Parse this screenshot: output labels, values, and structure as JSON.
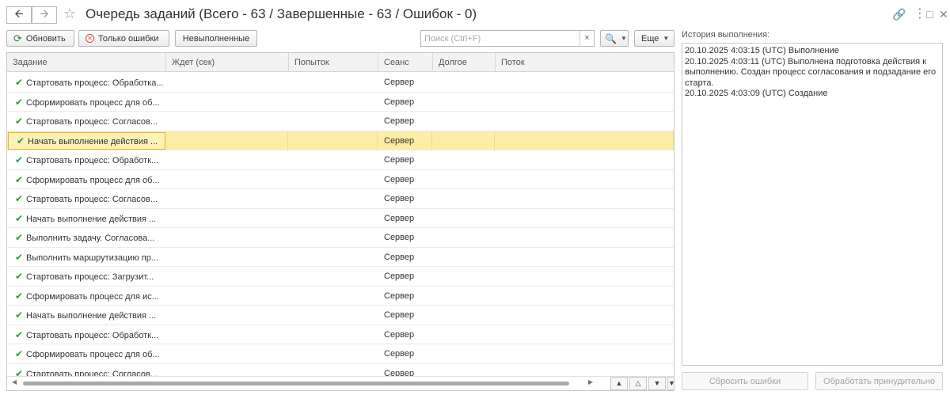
{
  "window": {
    "title": "Очередь заданий (Всего - 63 / Завершенные - 63 / Ошибок - 0)",
    "back_icon": "arrow-left-icon",
    "forward_icon": "arrow-right-icon",
    "favorite_icon": "star-icon",
    "link_icon": "link-icon",
    "menu_icon": "kebab-menu-icon",
    "maximize_icon": "maximize-icon",
    "close_icon": "close-icon"
  },
  "toolbar": {
    "refresh_label": "Обновить",
    "only_errors_label": "Только ошибки",
    "unfinished_label": "Невыполненные",
    "search_placeholder": "Поиск (Ctrl+F)",
    "search_clear": "×",
    "more_label": "Еще"
  },
  "grid": {
    "columns": {
      "task": "Задание",
      "wait": "Ждет (сек)",
      "tries": "Попыток",
      "session": "Сеанс",
      "long": "Долгое",
      "flow": "Поток"
    },
    "rows": [
      {
        "task": "Стартовать процесс: Обработка...",
        "wait": "",
        "tries": "",
        "session": "Сервер",
        "long": "",
        "flow": ""
      },
      {
        "task": "Сформировать процесс для об...",
        "wait": "",
        "tries": "",
        "session": "Сервер",
        "long": "",
        "flow": ""
      },
      {
        "task": "Стартовать процесс: Согласов...",
        "wait": "",
        "tries": "",
        "session": "Сервер",
        "long": "",
        "flow": ""
      },
      {
        "task": "Начать выполнение действия ...",
        "wait": "",
        "tries": "",
        "session": "Сервер",
        "long": "",
        "flow": "",
        "selected": true
      },
      {
        "task": "Стартовать процесс: Обработк...",
        "wait": "",
        "tries": "",
        "session": "Сервер",
        "long": "",
        "flow": ""
      },
      {
        "task": "Сформировать процесс для об...",
        "wait": "",
        "tries": "",
        "session": "Сервер",
        "long": "",
        "flow": ""
      },
      {
        "task": "Стартовать процесс: Согласов...",
        "wait": "",
        "tries": "",
        "session": "Сервер",
        "long": "",
        "flow": ""
      },
      {
        "task": "Начать выполнение действия ...",
        "wait": "",
        "tries": "",
        "session": "Сервер",
        "long": "",
        "flow": ""
      },
      {
        "task": "Выполнить задачу. Согласова...",
        "wait": "",
        "tries": "",
        "session": "Сервер",
        "long": "",
        "flow": ""
      },
      {
        "task": "Выполнить маршрутизацию пр...",
        "wait": "",
        "tries": "",
        "session": "Сервер",
        "long": "",
        "flow": ""
      },
      {
        "task": "Стартовать процесс: Загрузит...",
        "wait": "",
        "tries": "",
        "session": "Сервер",
        "long": "",
        "flow": ""
      },
      {
        "task": "Сформировать процесс для ис...",
        "wait": "",
        "tries": "",
        "session": "Сервер",
        "long": "",
        "flow": ""
      },
      {
        "task": "Начать выполнение действия ...",
        "wait": "",
        "tries": "",
        "session": "Сервер",
        "long": "",
        "flow": ""
      },
      {
        "task": "Стартовать процесс: Обработк...",
        "wait": "",
        "tries": "",
        "session": "Сервер",
        "long": "",
        "flow": ""
      },
      {
        "task": "Сформировать процесс для об...",
        "wait": "",
        "tries": "",
        "session": "Сервер",
        "long": "",
        "flow": ""
      },
      {
        "task": "Стартовать процесс: Согласов...",
        "wait": "",
        "tries": "",
        "session": "Сервер",
        "long": "",
        "flow": ""
      }
    ]
  },
  "history": {
    "label": "История выполнения:",
    "lines": [
      "20.10.2025 4:03:15 (UTC) Выполнение",
      "20.10.2025 4:03:11 (UTC) Выполнена подготовка действия к выполнению. Создан процесс согласования и подзадание его старта.",
      "20.10.2025 4:03:09 (UTC) Создание"
    ]
  },
  "actions": {
    "reset_errors_label": "Сбросить ошибки",
    "force_process_label": "Обработать принудительно"
  },
  "colors": {
    "selected_row": "#fbeca6",
    "check_mark": "#2e9a3a",
    "disabled_text": "#a5a5a5"
  }
}
